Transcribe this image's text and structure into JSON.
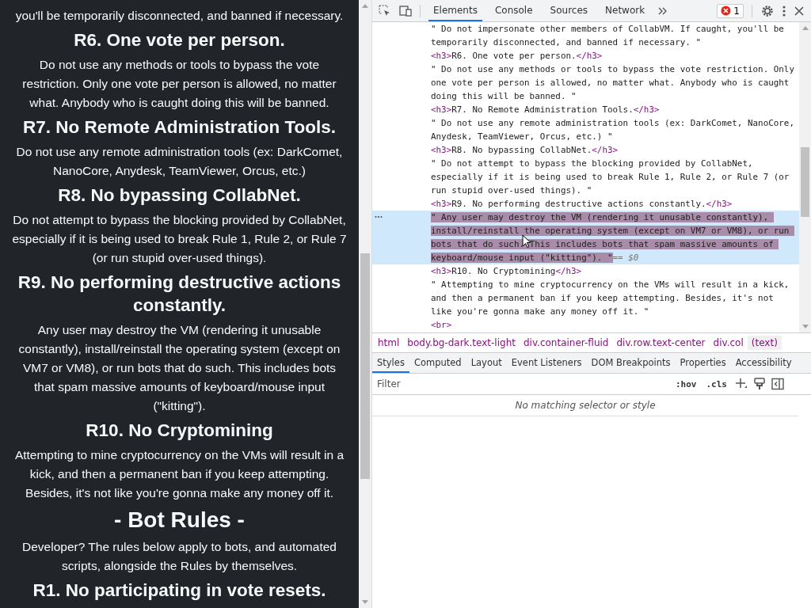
{
  "page": {
    "items": [
      {
        "kind": "paragraph",
        "text": "you'll be temporarily disconnected, and banned if necessary."
      },
      {
        "kind": "heading",
        "text": "R6. One vote per person."
      },
      {
        "kind": "paragraph",
        "text": "Do not use any methods or tools to bypass the vote restriction. Only one vote per person is allowed, no matter what. Anybody who is caught doing this will be banned."
      },
      {
        "kind": "heading",
        "text": "R7. No Remote Administration Tools."
      },
      {
        "kind": "paragraph",
        "text": "Do not use any remote administration tools (ex: DarkComet, NanoCore, Anydesk, TeamViewer, Orcus, etc.)"
      },
      {
        "kind": "heading",
        "text": "R8. No bypassing CollabNet."
      },
      {
        "kind": "paragraph",
        "text": "Do not attempt to bypass the blocking provided by CollabNet, especially if it is being used to break Rule 1, Rule 2, or Rule 7 (or run stupid over-used things)."
      },
      {
        "kind": "heading",
        "text": "R9. No performing destructive actions constantly."
      },
      {
        "kind": "paragraph",
        "text": "Any user may destroy the VM (rendering it unusable constantly), install/reinstall the operating system (except on VM7 or VM8), or run bots that do such. This includes bots that spam massive amounts of keyboard/mouse input (\"kitting\")."
      },
      {
        "kind": "heading",
        "text": "R10. No Cryptomining"
      },
      {
        "kind": "paragraph",
        "text": "Attempting to mine cryptocurrency on the VMs will result in a kick, and then a permanent ban if you keep attempting. Besides, it's not like you're gonna make any money off it."
      },
      {
        "kind": "title",
        "text": "- Bot Rules -"
      },
      {
        "kind": "paragraph",
        "text": "Developer? The rules below apply to bots, and automated scripts, alongside the Rules by themselves."
      },
      {
        "kind": "heading",
        "text": "R1. No participating in vote resets."
      }
    ]
  },
  "devtools": {
    "tabs": [
      {
        "label": "Elements",
        "selected": true
      },
      {
        "label": "Console",
        "selected": false
      },
      {
        "label": "Sources",
        "selected": false
      },
      {
        "label": "Network",
        "selected": false
      }
    ],
    "error_count": "1",
    "nodes": [
      {
        "kind": "text",
        "text": "\" Do not impersonate other members of CollabVM. If caught, you'll be temporarily disconnected, and banned if necessary. \"",
        "selected": false
      },
      {
        "kind": "tag",
        "open": "<h3>",
        "text": "R6. One vote per person.",
        "close": "</h3>",
        "selected": false
      },
      {
        "kind": "text",
        "text": "\" Do not use any methods or tools to bypass the vote restriction. Only one vote per person is allowed, no matter what. Anybody who is caught doing this will be banned. \"",
        "selected": false
      },
      {
        "kind": "tag",
        "open": "<h3>",
        "text": "R7. No Remote Administration Tools.",
        "close": "</h3>",
        "selected": false
      },
      {
        "kind": "text",
        "text": "\" Do not use any remote administration tools (ex: DarkComet, NanoCore, Anydesk, TeamViewer, Orcus, etc.) \"",
        "selected": false
      },
      {
        "kind": "tag",
        "open": "<h3>",
        "text": "R8. No bypassing CollabNet.",
        "close": "</h3>",
        "selected": false
      },
      {
        "kind": "text",
        "text": "\" Do not attempt to bypass the blocking provided by CollabNet, especially if it is being used to break Rule 1, Rule 2, or Rule 7 (or run stupid over-used things). \"",
        "selected": false
      },
      {
        "kind": "tag",
        "open": "<h3>",
        "text": "R9. No performing destructive actions constantly.",
        "close": "</h3>",
        "selected": false
      },
      {
        "kind": "text",
        "text": "\" Any user may destroy the VM (rendering it unusable constantly), install/reinstall the operating system (except on VM7 or VM8), or run bots that do such. This includes bots that spam massive amounts of keyboard/mouse input (\"kitting\"). \"",
        "selected": true,
        "marker": "== $0"
      },
      {
        "kind": "tag",
        "open": "<h3>",
        "text": "R10. No Cryptomining",
        "close": "</h3>",
        "selected": false
      },
      {
        "kind": "text",
        "text": "\" Attempting to mine cryptocurrency on the VMs will result in a kick, and then a permanent ban if you keep attempting. Besides, it's not like you're gonna make any money off it. \"",
        "selected": false
      },
      {
        "kind": "tag",
        "open": "<br>",
        "selected": false
      }
    ],
    "breadcrumbs": [
      {
        "label": "html",
        "selected": false
      },
      {
        "label": "body.bg-dark.text-light",
        "selected": false
      },
      {
        "label": "div.container-fluid",
        "selected": false
      },
      {
        "label": "div.row.text-center",
        "selected": false
      },
      {
        "label": "div.col",
        "selected": false
      },
      {
        "label": "(text)",
        "selected": true
      }
    ],
    "style_tabs": [
      {
        "label": "Styles",
        "selected": true
      },
      {
        "label": "Computed",
        "selected": false
      },
      {
        "label": "Layout",
        "selected": false
      },
      {
        "label": "Event Listeners",
        "selected": false
      },
      {
        "label": "DOM Breakpoints",
        "selected": false
      },
      {
        "label": "Properties",
        "selected": false
      },
      {
        "label": "Accessibility",
        "selected": false
      }
    ],
    "filter": {
      "placeholder": "Filter"
    },
    "hov": ":hov",
    "cls": ".cls",
    "empty_message": "No matching selector or style"
  }
}
